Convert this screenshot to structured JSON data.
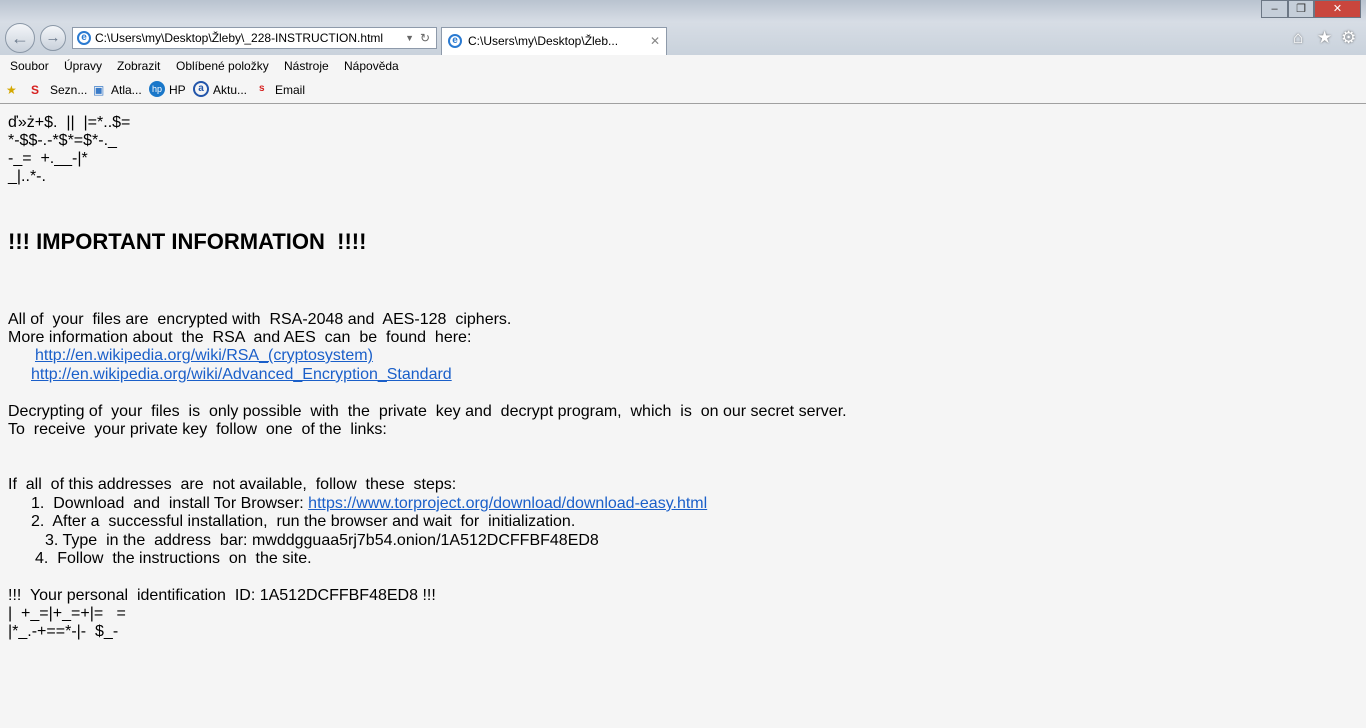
{
  "browser": {
    "address": "C:\\Users\\my\\Desktop\\Žleby\\_228-INSTRUCTION.html",
    "tab_title": "C:\\Users\\my\\Desktop\\Žleb...",
    "menu": [
      "Soubor",
      "Úpravy",
      "Zobrazit",
      "Oblíbené položky",
      "Nástroje",
      "Nápověda"
    ],
    "favorites": [
      "Sezn...",
      "Atla...",
      "HP",
      "Aktu...",
      "Email"
    ]
  },
  "page": {
    "garbage_top": [
      "ď»ż+$.  ||  |=*..$=",
      "*-$$-.-*$*=$*-._",
      "-_=  +.__-|*",
      "_|..*-."
    ],
    "heading": "!!! IMPORTANT INFORMATION  !!!!",
    "p1": "All of  your  files are  encrypted with  RSA-2048 and  AES-128  ciphers.",
    "p2": "More information about  the  RSA  and AES  can  be  found  here:",
    "link1": "http://en.wikipedia.org/wiki/RSA_(cryptosystem)",
    "link2": "http://en.wikipedia.org/wiki/Advanced_Encryption_Standard",
    "p3": "Decrypting of  your  files  is  only possible  with  the  private  key and  decrypt program,  which  is  on our secret server.",
    "p4": "To  receive  your private key  follow  one  of the  links:",
    "p5": "If  all  of this addresses  are  not available,  follow  these  steps:",
    "step1": "1.  Download  and  install Tor Browser: ",
    "step1_link": "https://www.torproject.org/download/download-easy.html",
    "step2": "2.  After a  successful installation,  run the browser and wait  for  initialization.",
    "step3": "3. Type  in the  address  bar: mwddgguaa5rj7b54.onion/1A512DCFFBF48ED8",
    "step4": "4.  Follow  the instructions  on  the site.",
    "id_line": "!!!  Your personal  identification  ID: 1A512DCFFBF48ED8 !!!",
    "garbage_bottom": [
      "|  +_=|+_=+|=   =",
      "|*_.-+==*-|-  $_-"
    ]
  }
}
